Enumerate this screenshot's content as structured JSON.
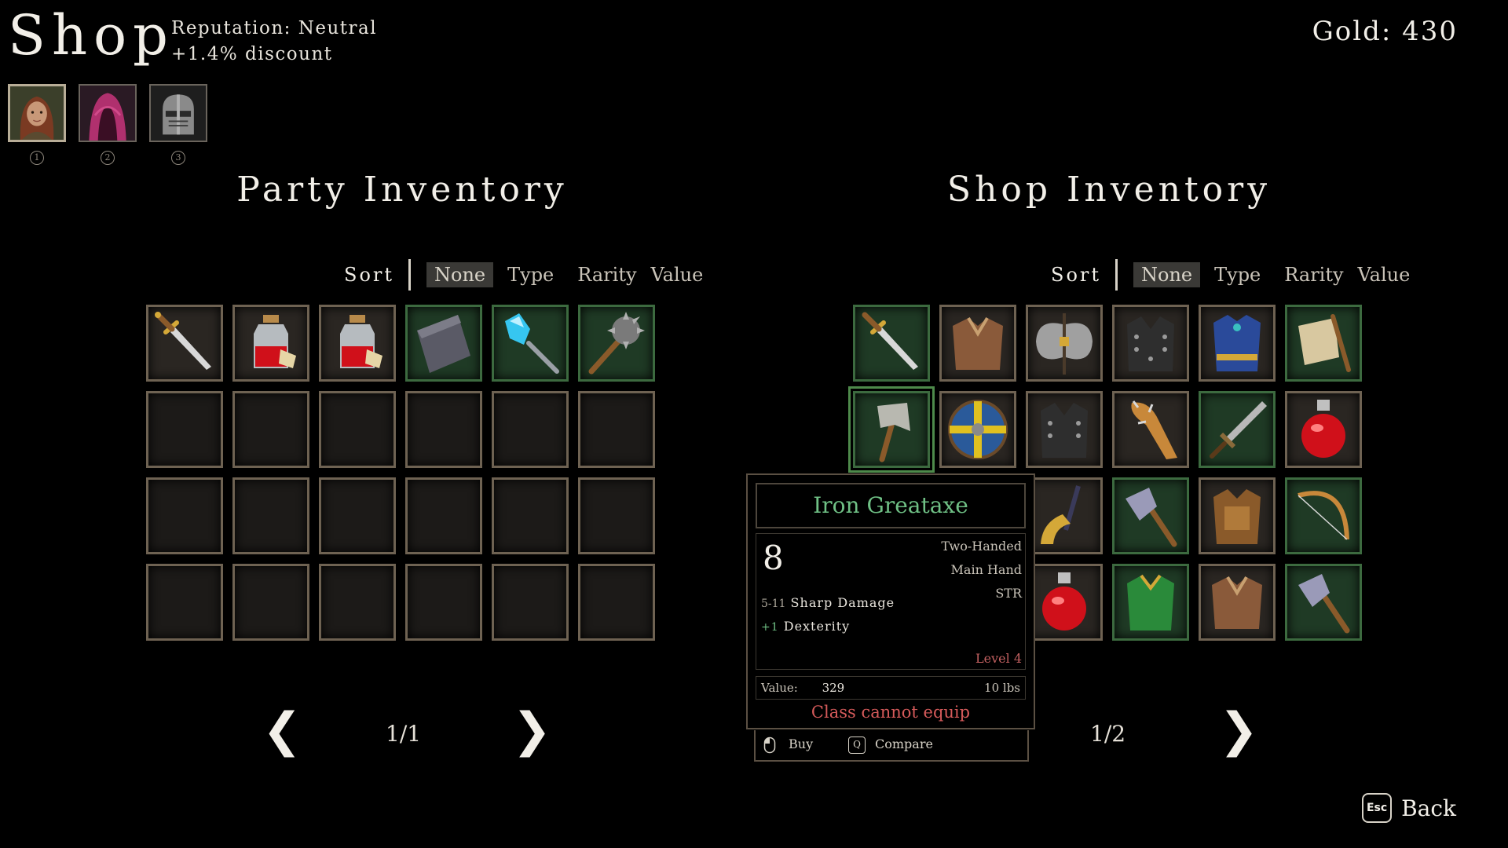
{
  "header": {
    "title": "Shop",
    "reputation": "Reputation: Neutral",
    "discount": "+1.4% discount",
    "gold": "Gold: 430"
  },
  "party_members": [
    {
      "icon": "female-warrior-portrait",
      "number": "1",
      "selected": true
    },
    {
      "icon": "hooded-rogue-portrait",
      "number": "2",
      "selected": false
    },
    {
      "icon": "knight-helmet-portrait",
      "number": "3",
      "selected": false
    }
  ],
  "party_inventory": {
    "title": "Party Inventory",
    "sort_label": "Sort",
    "sort_options": [
      "None",
      "Type",
      "Rarity",
      "Value"
    ],
    "sort_active": "None",
    "page": "1/1",
    "items": [
      "dagger-icon",
      "health-potion-jar-icon",
      "health-potion-jar-icon",
      "stone-slab-icon",
      "crystal-wand-icon",
      "spiked-mace-icon"
    ]
  },
  "shop_inventory": {
    "title": "Shop Inventory",
    "sort_label": "Sort",
    "sort_options": [
      "None",
      "Type",
      "Rarity",
      "Value"
    ],
    "sort_active": "None",
    "page": "1/2",
    "items": [
      "dagger-icon",
      "leather-armor-icon",
      "battle-axe-icon",
      "studded-vest-icon",
      "blue-tunic-icon",
      "scroll-icon",
      "iron-greataxe-icon",
      "round-shield-icon",
      "studded-vest-icon",
      "spiked-club-icon",
      "short-sword-icon",
      "red-potion-icon",
      "hidden",
      "hidden",
      "curved-blade-icon",
      "hand-axe-icon",
      "bronze-armor-icon",
      "bow-icon",
      "hidden",
      "hidden",
      "red-potion-icon",
      "green-armor-icon",
      "leather-armor-icon",
      "hand-axe-icon"
    ]
  },
  "tooltip": {
    "name": "Iron Greataxe",
    "big_value": "8",
    "handedness": "Two-Handed",
    "slot": "Main Hand",
    "stat": "STR",
    "damage_range": "5-11",
    "damage_type": "Sharp Damage",
    "bonus_amount": "+1",
    "bonus_stat": "Dexterity",
    "level": "Level 4",
    "value_label": "Value:",
    "value": "329",
    "weight": "10 lbs",
    "warning": "Class cannot equip"
  },
  "actions": {
    "buy": "Buy",
    "compare_key": "Q",
    "compare": "Compare"
  },
  "back": {
    "key": "Esc",
    "label": "Back"
  },
  "colors": {
    "accent_green": "#6fc085",
    "warning_red": "#d55a5a",
    "slot_border": "#6e6252"
  }
}
